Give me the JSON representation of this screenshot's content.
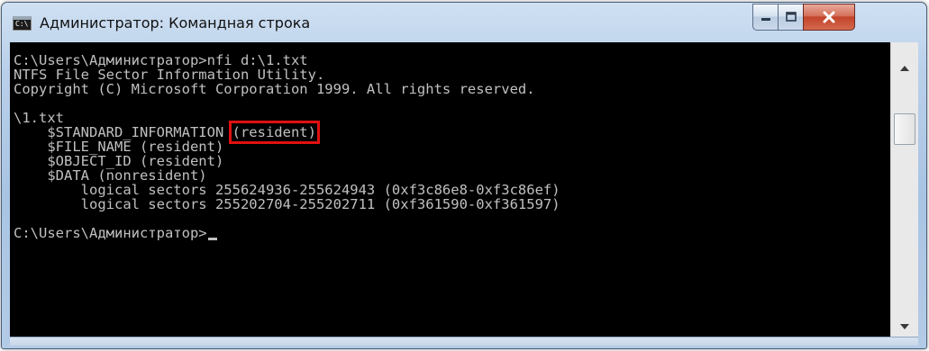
{
  "window": {
    "title": "Администратор: Командная строка",
    "title_icon_text": "C:\\",
    "controls": {
      "minimize": "minimize",
      "maximize": "maximize",
      "close": "close"
    },
    "accent_color": "#e01010"
  },
  "console": {
    "lines": [
      "C:\\Users\\Администратор>nfi d:\\1.txt",
      "NTFS File Sector Information Utility.",
      "Copyright (C) Microsoft Corporation 1999. All rights reserved.",
      "",
      "\\1.txt",
      "    $STANDARD_INFORMATION ",
      "    $FILE_NAME (resident)",
      "    $OBJECT_ID (resident)",
      "    $DATA (nonresident)",
      "        logical sectors 255624936-255624943 (0xf3c86e8-0xf3c86ef)",
      "        logical sectors 255202704-255202711 (0xf361590-0xf361597)",
      "",
      "C:\\Users\\Администратор>"
    ],
    "highlighted": "(resident)"
  }
}
